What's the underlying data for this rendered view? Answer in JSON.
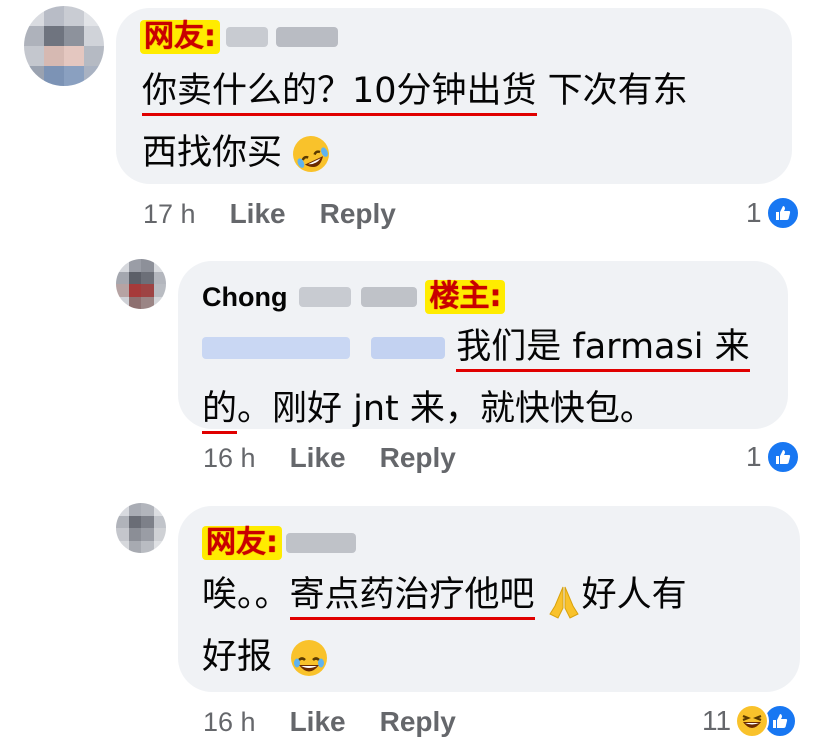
{
  "comments": [
    {
      "tag": "网友:",
      "text_underlined": "你卖什么的？10分钟出货",
      "text_rest_1": " 下次有东",
      "text_rest_2": "西找你买",
      "emoji": "rolling-laughing",
      "time": "17 h",
      "like_label": "Like",
      "reply_label": "Reply",
      "reaction_count": "1",
      "reaction_icons": [
        "like-icon"
      ]
    },
    {
      "name": "Chong",
      "tag": "楼主:",
      "line1_underlined": "我们是 farmasi 来",
      "line2_underlined": "的",
      "line2_rest": "。刚好 jnt 来，就快快包。",
      "time": "16 h",
      "like_label": "Like",
      "reply_label": "Reply",
      "reaction_count": "1",
      "reaction_icons": [
        "like-icon"
      ]
    },
    {
      "tag": "网友:",
      "line1_plain": "唉。。",
      "line1_underlined": "寄点药治疗他吧",
      "line1_rest": "好人有",
      "line2": "好报",
      "emoji_1": "folded-hands",
      "emoji_2": "grinning-sweat",
      "time": "16 h",
      "like_label": "Like",
      "reply_label": "Reply",
      "reaction_count": "11",
      "reaction_icons": [
        "laughing-icon",
        "like-icon"
      ]
    }
  ],
  "colors": {
    "bubble": "#f0f2f5",
    "tag_bg": "#ffec00",
    "tag_text": "#c90000",
    "underline": "#e00000",
    "meta_text": "#65676b",
    "like_blue": "#1877f2"
  }
}
